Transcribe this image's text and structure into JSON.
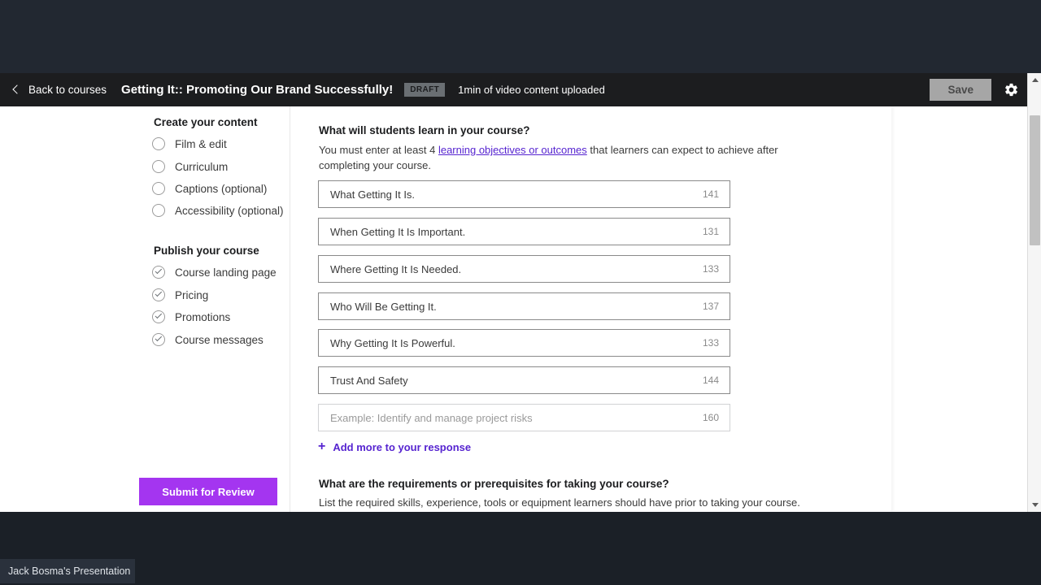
{
  "header": {
    "back_label": "Back to courses",
    "course_title": "Getting It:: Promoting Our Brand Successfully!",
    "draft_badge": "DRAFT",
    "upload_status": "1min of video content uploaded",
    "save_label": "Save",
    "gear_icon": "gear-icon",
    "back_icon": "chevron-left-icon",
    "bar_color": "#1c1d1f"
  },
  "sidebar": {
    "groups": [
      {
        "title": "Create your content",
        "items": [
          {
            "label": "Film & edit",
            "done": false
          },
          {
            "label": "Curriculum",
            "done": false
          },
          {
            "label": "Captions (optional)",
            "done": false
          },
          {
            "label": "Accessibility (optional)",
            "done": false
          }
        ]
      },
      {
        "title": "Publish your course",
        "items": [
          {
            "label": "Course landing page",
            "done": true
          },
          {
            "label": "Pricing",
            "done": true
          },
          {
            "label": "Promotions",
            "done": true
          },
          {
            "label": "Course messages",
            "done": true
          }
        ]
      }
    ],
    "submit_label": "Submit for Review",
    "submit_color": "#a435f0"
  },
  "main": {
    "learn_section": {
      "title": "What will students learn in your course?",
      "desc_before": "You must enter at least 4 ",
      "desc_link": "learning objectives or outcomes",
      "desc_after": " that learners can expect to achieve after completing your course.",
      "objectives": [
        {
          "text": "What Getting It Is.",
          "count": "141",
          "placeholder": false
        },
        {
          "text": "When Getting It Is Important.",
          "count": "131",
          "placeholder": false
        },
        {
          "text": "Where Getting It Is Needed.",
          "count": "133",
          "placeholder": false
        },
        {
          "text": "Who Will Be Getting It.",
          "count": "137",
          "placeholder": false
        },
        {
          "text": "Why Getting It Is Powerful.",
          "count": "133",
          "placeholder": false
        },
        {
          "text": "Trust And Safety",
          "count": "144",
          "placeholder": false
        },
        {
          "text": "Example: Identify and manage project risks",
          "count": "160",
          "placeholder": true
        }
      ],
      "add_more_label": "Add more to your response",
      "add_more_icon": "plus-icon",
      "link_color": "#5624d0"
    },
    "requirements_section": {
      "title": "What are the requirements or prerequisites for taking your course?",
      "desc": "List the required skills, experience, tools or equipment learners should have prior to taking your course."
    }
  },
  "scrollbar": {
    "up_icon": "scroll-up-arrow-icon",
    "down_icon": "scroll-down-arrow-icon"
  },
  "taskbar": {
    "window_label": "Jack Bosma's Presentation"
  }
}
